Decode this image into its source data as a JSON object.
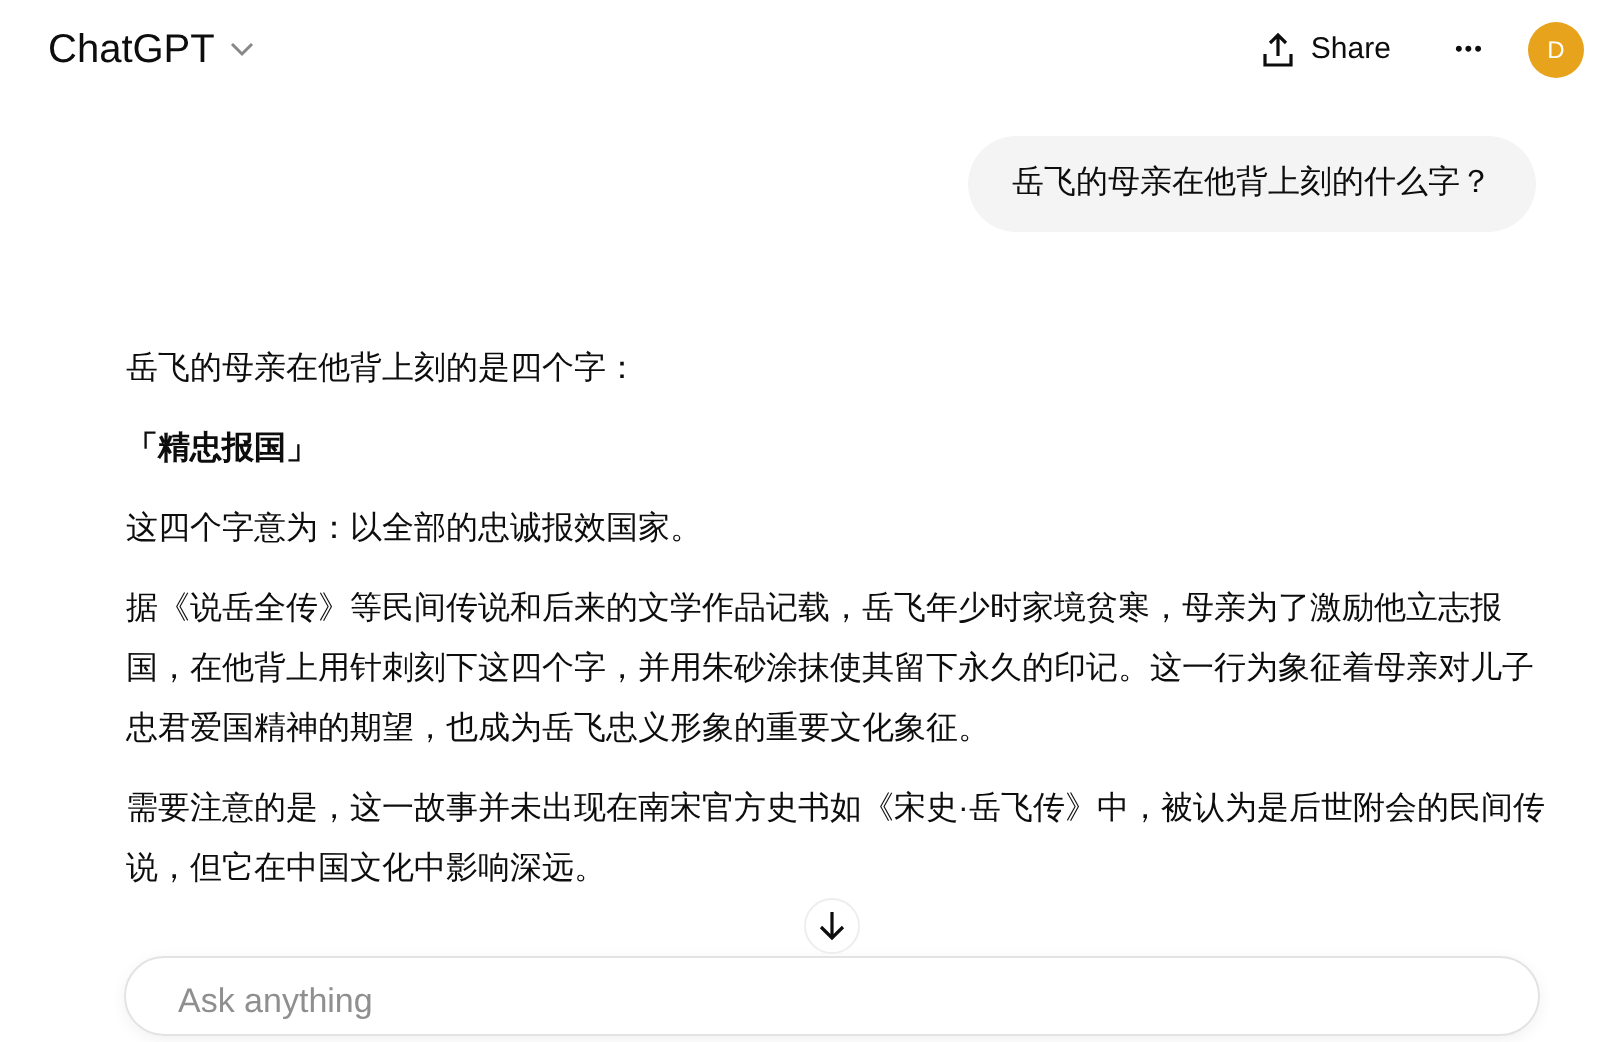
{
  "header": {
    "title": "ChatGPT",
    "share": "Share",
    "more": "•••",
    "avatar": "D"
  },
  "user_message": "岳飞的母亲在他背上刻的什么字？",
  "answer": [
    {
      "kind": "text",
      "text": "岳飞的母亲在他背上刻的是四个字："
    },
    {
      "kind": "strong",
      "text": "「精忠报国」"
    },
    {
      "kind": "text",
      "text": "这四个字意为：以全部的忠诚报效国家。"
    },
    {
      "kind": "text",
      "text": "据《说岳全传》等民间传说和后来的文学作品记载，岳飞年少时家境贫寒，母亲为了激励他立志报国，在他背上用针刺刻下这四个字，并用朱砂涂抹使其留下永久的印记。这一行为象征着母亲对儿子忠君爱国精神的期望，也成为岳飞忠义形象的重要文化象征。"
    },
    {
      "kind": "text",
      "text": "需要注意的是，这一故事并未出现在南宋官方史书如《宋史·岳飞传》中，被认为是后世附会的民间传说，但它在中国文化中影响深远。"
    }
  ],
  "composer": {
    "placeholder": "Ask anything"
  }
}
